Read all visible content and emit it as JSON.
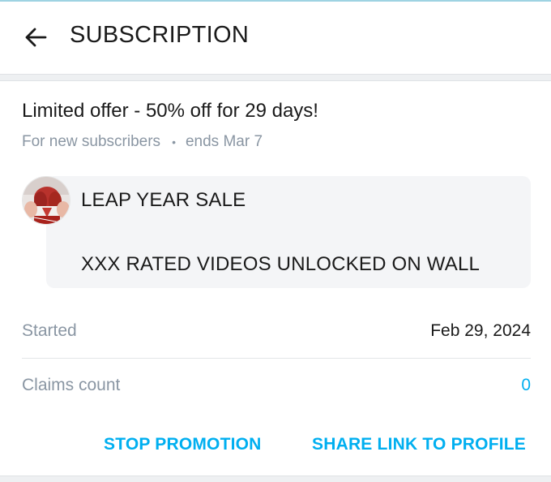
{
  "header": {
    "title": "SUBSCRIPTION",
    "back_icon": "arrow-left-icon"
  },
  "offer": {
    "title": "Limited offer - 50% off for 29 days!",
    "audience": "For new subscribers",
    "separator": "•",
    "ends": "ends Mar 7"
  },
  "message": {
    "line1": "LEAP YEAR SALE",
    "line2": "XXX RATED VIDEOS UNLOCKED ON WALL"
  },
  "details": {
    "started_label": "Started",
    "started_value": "Feb 29, 2024",
    "claims_label": "Claims count",
    "claims_value": "0"
  },
  "actions": {
    "stop_label": "STOP PROMOTION",
    "share_label": "SHARE LINK TO PROFILE"
  },
  "colors": {
    "accent": "#00aff0",
    "muted_text": "#8a96a3",
    "bubble_bg": "#f4f5f7"
  }
}
